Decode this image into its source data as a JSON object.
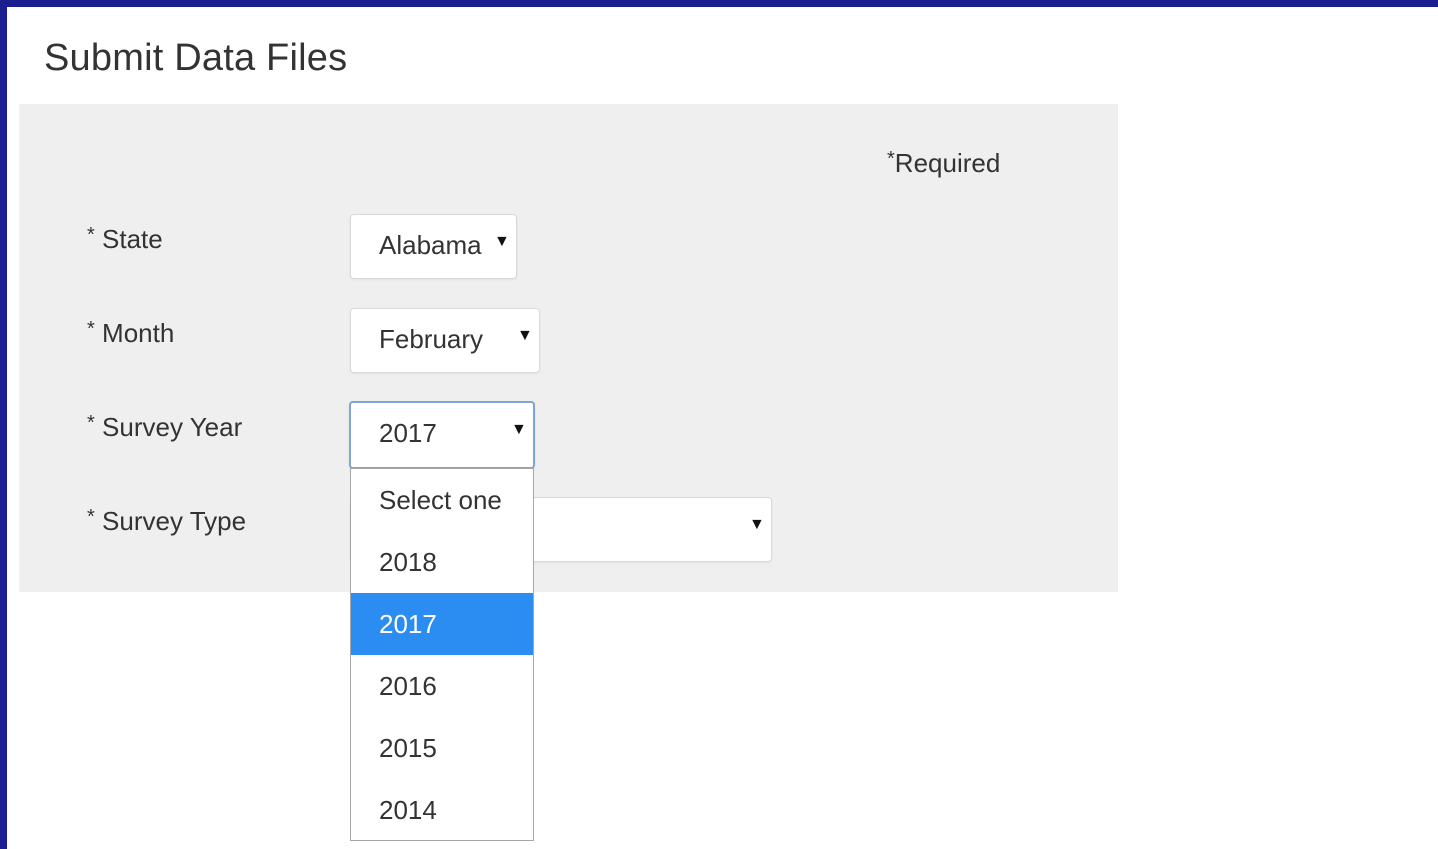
{
  "page": {
    "title": "Submit Data Files"
  },
  "form": {
    "required_note": "Required",
    "required_mark": "*",
    "fields": [
      {
        "label": "State",
        "value": "Alabama"
      },
      {
        "label": "Month",
        "value": "February"
      },
      {
        "label": "Survey Year",
        "value": "2017"
      },
      {
        "label": "Survey Type",
        "value": ""
      }
    ]
  },
  "dropdown": {
    "options": [
      "Select one",
      "2018",
      "2017",
      "2016",
      "2015",
      "2014"
    ],
    "highlighted": "2017"
  },
  "icons": {
    "caret": "caret-down-icon"
  },
  "colors": {
    "frame": "#1b1f8f",
    "panel": "#efefef",
    "highlight": "#2b8df2"
  }
}
